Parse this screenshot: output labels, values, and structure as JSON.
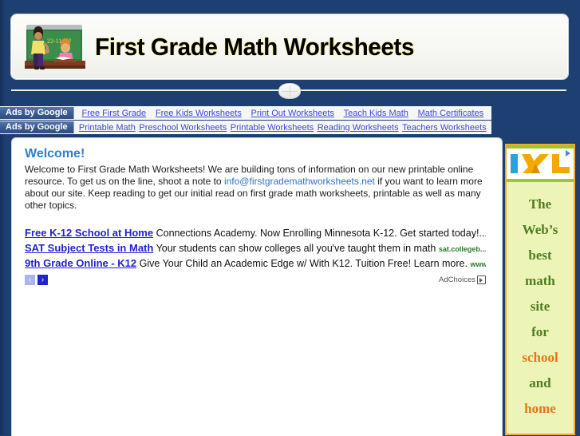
{
  "site": {
    "title": "First Grade Math Worksheets",
    "logo_alt": "teacher-chalkboard-logo",
    "logo_equation": "22-11 = ?",
    "background_color": "#1d3f72",
    "accent_color": "#2f7fd1"
  },
  "ads_bars": [
    {
      "badge": "Ads by Google",
      "links": [
        "Free First Grade",
        "Free Kids Worksheets",
        "Print Out Worksheets",
        "Teach Kids Math",
        "Math Certificates"
      ]
    },
    {
      "badge": "Ads by Google",
      "links": [
        "Printable Math",
        "Preschool Worksheets",
        "Printable Worksheets",
        "Reading Worksheets",
        "Teachers Worksheets"
      ]
    }
  ],
  "welcome": {
    "heading": "Welcome!",
    "body_part1": "Welcome to First Grade Math Worksheets! We are building tons of information on our new printable online resource. To get us on the line, shoot a note to ",
    "email": "info@firstgrademathworksheets.net",
    "body_part2": " if you want to learn more about our site. Keep reading to get our initial read on first grade math worksheets, printable as well as many other topics."
  },
  "text_ads": {
    "items": [
      {
        "title": "Free K-12 School at Home",
        "description": "Connections Academy. Now Enrolling Minnesota K-12. Get started today!...",
        "url": ""
      },
      {
        "title": "SAT Subject Tests in Math",
        "description": "Your students can show colleges all you've taught them in math",
        "url": "sat.collegeb..."
      },
      {
        "title": "9th Grade Online - K12",
        "description": "Give Your Child an Academic Edge w/ With K12. Tuition Free! Learn more.",
        "url": "www..."
      }
    ],
    "prev_label": "‹",
    "next_label": "›",
    "adchoices_label": "AdChoices"
  },
  "sidebar_ad": {
    "brand": "IXL",
    "brand_colors": [
      "#29a3dc",
      "#f5a800"
    ],
    "border_color": "#f0a830",
    "background_color": "#ecf5b7",
    "lines": [
      {
        "text": "The",
        "highlight": false
      },
      {
        "text": "Web’s",
        "highlight": false
      },
      {
        "text": "best",
        "highlight": false
      },
      {
        "text": "math",
        "highlight": false
      },
      {
        "text": "site",
        "highlight": false
      },
      {
        "text": "for",
        "highlight": false
      },
      {
        "text": "school",
        "highlight": true
      },
      {
        "text": "and",
        "highlight": false
      },
      {
        "text": "home",
        "highlight": true
      }
    ]
  }
}
